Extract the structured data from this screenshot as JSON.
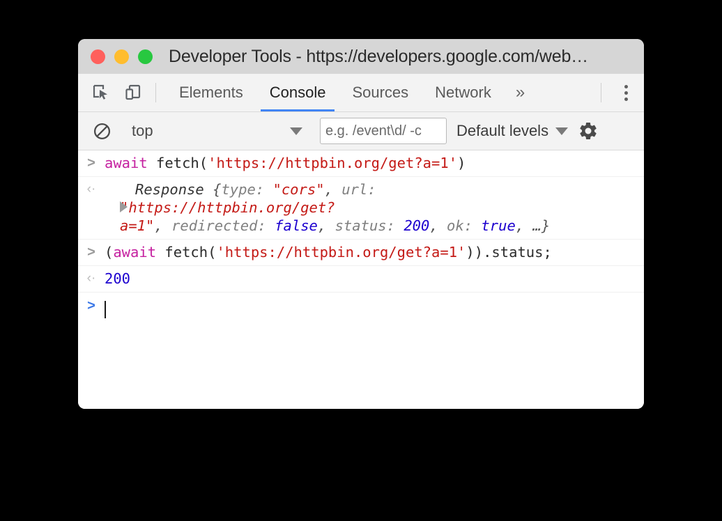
{
  "window": {
    "title": "Developer Tools - https://developers.google.com/web…",
    "traffic_lights": [
      {
        "name": "close",
        "color": "#ff605c"
      },
      {
        "name": "minimize",
        "color": "#ffbd2e"
      },
      {
        "name": "maximize",
        "color": "#28c840"
      }
    ]
  },
  "tabbar": {
    "inspect_icon": "inspect-element-icon",
    "device_icon": "device-toolbar-icon",
    "tabs": [
      {
        "label": "Elements",
        "active": false
      },
      {
        "label": "Console",
        "active": true
      },
      {
        "label": "Sources",
        "active": false
      },
      {
        "label": "Network",
        "active": false
      }
    ],
    "overflow_label": "»",
    "menu_icon": "kebab-menu-icon",
    "active_underline_color": "#4285f4"
  },
  "console_toolbar": {
    "clear_icon": "clear-console-icon",
    "context": "top",
    "context_caret": "chevron-down-icon",
    "filter_placeholder": "e.g. /event\\d/ -c",
    "filter_value": "",
    "levels_label": "Default levels",
    "levels_caret": "chevron-down-icon",
    "settings_icon": "gear-icon"
  },
  "console": {
    "entries": [
      {
        "kind": "input",
        "gutter": ">",
        "command_prefix": "",
        "keyword": "await",
        "call_open": " fetch(",
        "string": "'https://httpbin.org/get?a=1'",
        "call_close": ")"
      },
      {
        "kind": "result_object",
        "gutter": "‹·",
        "name": "Response ",
        "open_brace": "{",
        "prop_type": "type: ",
        "value_type": "\"cors\"",
        "sep1": ", ",
        "prop_url": "url:",
        "url_string_line1": "\"https://httpbin.org/get?",
        "url_string_line2": "a=1\"",
        "sep2": ", ",
        "prop_redirected": "redirected: ",
        "value_redirected": "false",
        "sep3": ", ",
        "prop_status": "status: ",
        "value_status": "200",
        "sep4": ", ",
        "prop_ok": "ok: ",
        "value_ok": "true",
        "tail": ", …}"
      },
      {
        "kind": "input",
        "gutter": ">",
        "command_prefix": "(",
        "keyword": "await",
        "call_open": " fetch(",
        "string": "'https://httpbin.org/get?a=1'",
        "call_close": ")).status;"
      },
      {
        "kind": "result_value",
        "gutter": "‹·",
        "value": "200"
      }
    ],
    "prompt": {
      "gutter": ">",
      "value": ""
    }
  },
  "colors": {
    "accent": "#4285f4",
    "string": "#c41a16",
    "keyword": "#c521a0",
    "number": "#1c00cf",
    "property": "#808080",
    "page_background": "#000000",
    "window_background": "#ffffff",
    "chrome_background": "#f3f3f3",
    "titlebar_background": "#d6d6d6"
  }
}
